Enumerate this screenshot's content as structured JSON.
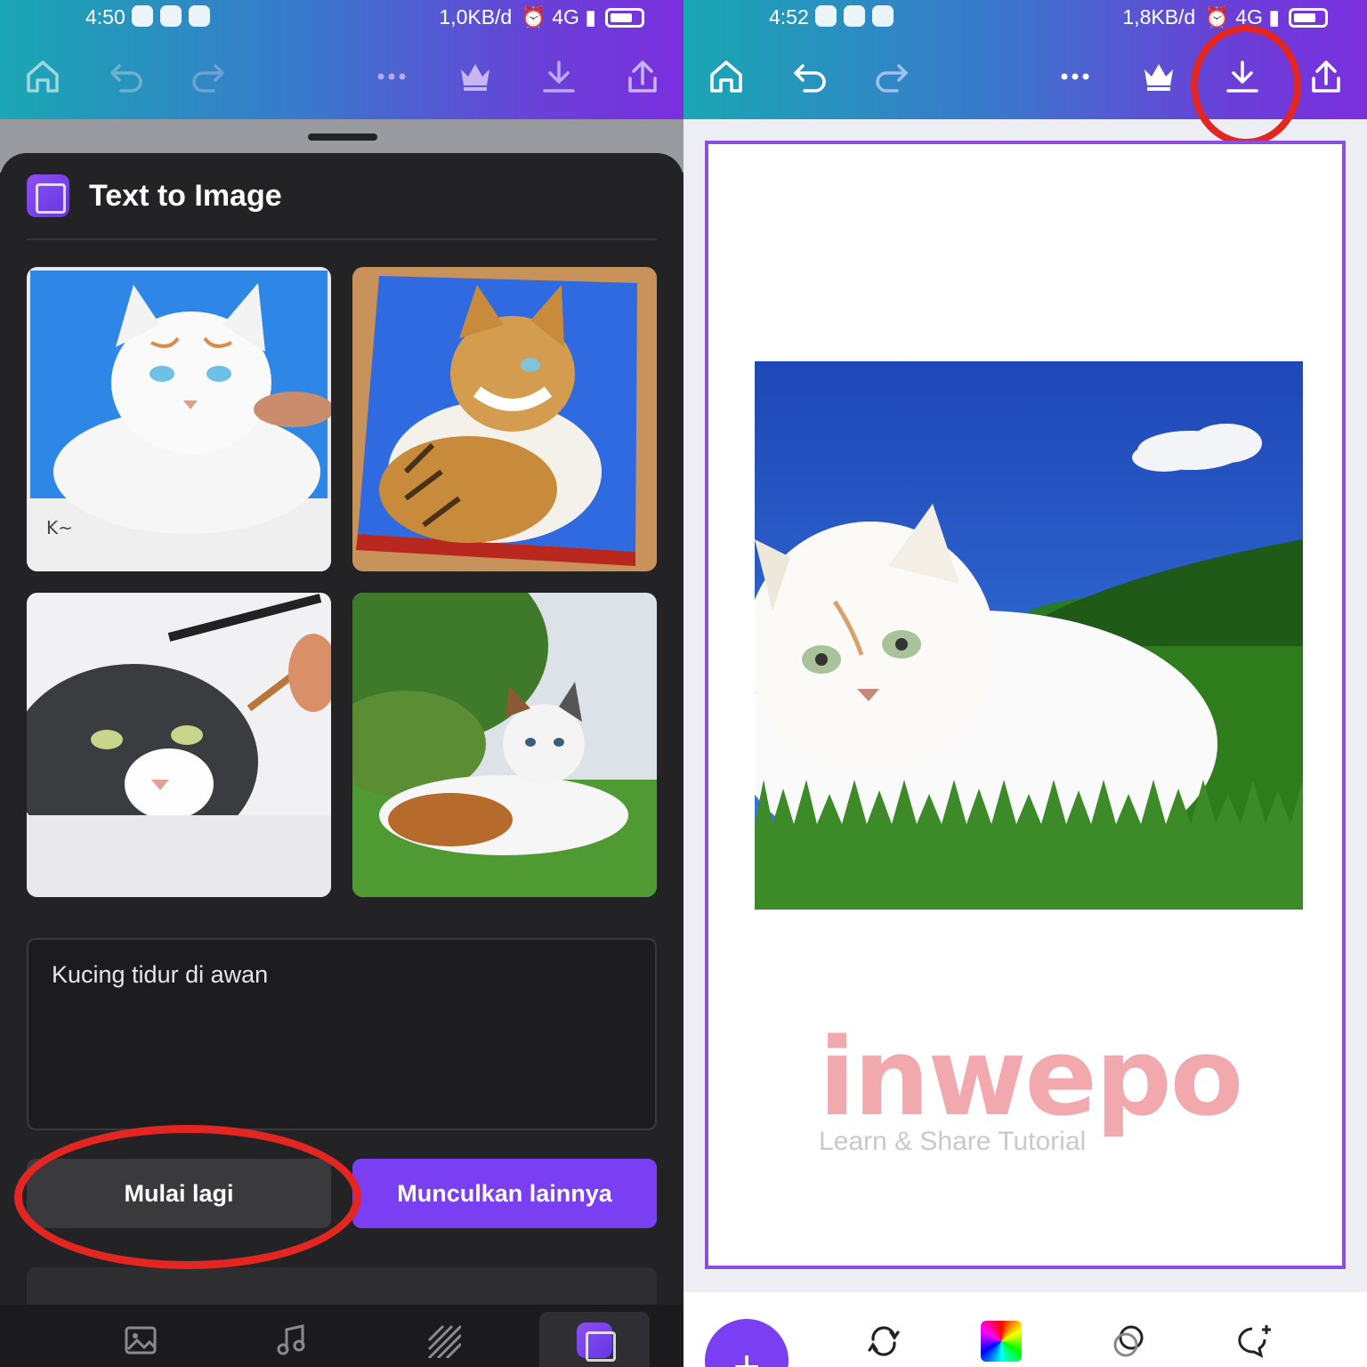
{
  "left": {
    "status": {
      "time": "4:50",
      "net": "1,0KB/d"
    },
    "sheet": {
      "title": "Text to Image",
      "prompt": "Kucing tidur di awan",
      "restart_label": "Mulai lagi",
      "generate_more_label": "Munculkan lainnya"
    },
    "thumbnails": [
      "white cat drawing",
      "tabby cat painting",
      "grey cat pencil drawing",
      "calico cat on grass"
    ],
    "nav": [
      "image-icon",
      "music-icon",
      "pattern-icon",
      "text-to-image-icon"
    ]
  },
  "right": {
    "status": {
      "time": "4:52",
      "net": "1,8KB/d"
    },
    "watermark": {
      "logo": "inwepo",
      "tagline": "Learn & Share Tutorial"
    }
  },
  "colors": {
    "accent": "#7a3ef3",
    "highlight": "#e32622",
    "canvas_border": "#8b4fe0"
  },
  "icons": [
    "home-icon",
    "undo-icon",
    "redo-icon",
    "more-icon",
    "crown-icon",
    "download-icon",
    "share-icon"
  ]
}
